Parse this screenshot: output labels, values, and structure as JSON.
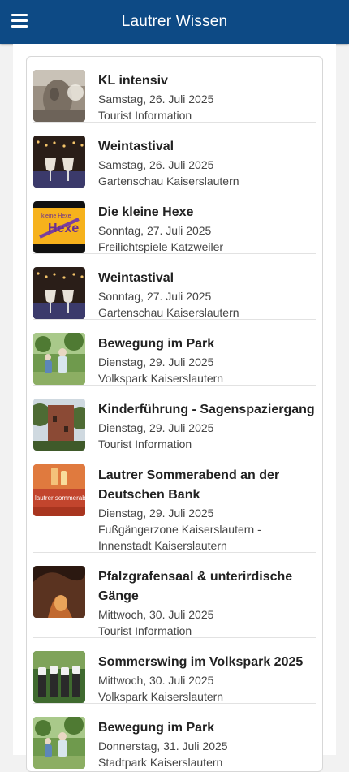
{
  "app": {
    "title": "Lautrer Wissen"
  },
  "icons": {
    "menu": "menu-icon"
  },
  "events": [
    {
      "title": "KL intensiv",
      "date": "Samstag, 26. Juli 2025",
      "location": "Tourist Information",
      "image": "statue-photo"
    },
    {
      "title": "Weintastival",
      "date": "Samstag, 26. Juli 2025",
      "location": "Gartenschau Kaiserslautern",
      "image": "wine-glasses-photo"
    },
    {
      "title": "Die kleine Hexe",
      "date": "Sonntag, 27. Juli 2025",
      "location": "Freilichtspiele Katzweiler",
      "image": "hexe-logo",
      "image_text": "kleine Hexe"
    },
    {
      "title": "Weintastival",
      "date": "Sonntag, 27. Juli 2025",
      "location": "Gartenschau Kaiserslautern",
      "image": "wine-glasses-photo"
    },
    {
      "title": "Bewegung im Park",
      "date": "Dienstag, 29. Juli 2025",
      "location": "Volkspark Kaiserslautern",
      "image": "park-exercise-photo"
    },
    {
      "title": "Kinderführung - Sagenspaziergang",
      "date": "Dienstag, 29. Juli 2025",
      "location": "Tourist Information",
      "image": "tower-photo"
    },
    {
      "title": "Lautrer Sommerabend an der Deutschen Bank",
      "date": "Dienstag, 29. Juli 2025",
      "location": "Fußgängerzone Kaiserslautern - Innenstadt Kaiserslautern",
      "image": "sommerabend-poster",
      "image_text": "lautrer sommerabende"
    },
    {
      "title": "Pfalzgrafensaal & unterirdische Gänge",
      "date": "Mittwoch, 30. Juli 2025",
      "location": "Tourist Information",
      "image": "cave-photo"
    },
    {
      "title": "Sommerswing im Volkspark 2025",
      "date": "Mittwoch, 30. Juli 2025",
      "location": "Volkspark Kaiserslautern",
      "image": "band-photo"
    },
    {
      "title": "Bewegung im Park",
      "date": "Donnerstag, 31. Juli 2025",
      "location": "Stadtpark Kaiserslautern",
      "image": "park-exercise-photo"
    }
  ]
}
